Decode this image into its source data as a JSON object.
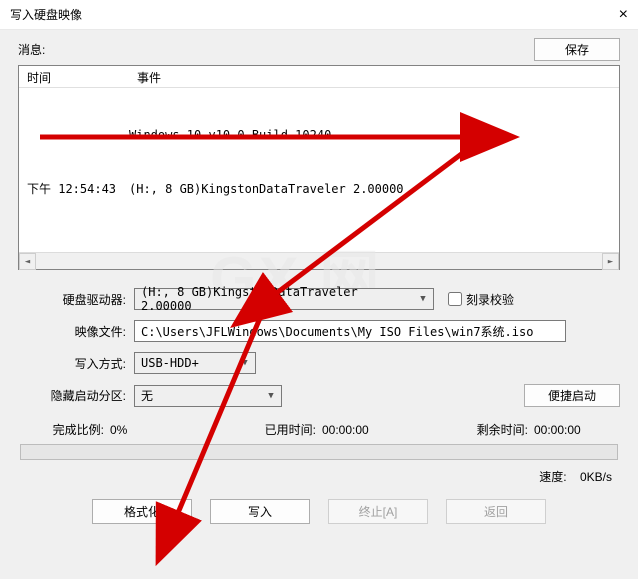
{
  "window": {
    "title": "写入硬盘映像"
  },
  "info": {
    "label": "消息:",
    "save_label": "保存",
    "col_time": "时间",
    "col_event": "事件",
    "rows": [
      {
        "time": "",
        "event": "Windows 10 v10.0 Build 10240"
      },
      {
        "time": "下午 12:54:43",
        "event": "(H:, 8 GB)KingstonDataTraveler 2.00000"
      }
    ]
  },
  "form": {
    "drive_label": "硬盘驱动器:",
    "drive_value": "(H:, 8 GB)KingstonDataTraveler 2.00000",
    "burn_check_label": "刻录校验",
    "image_label": "映像文件:",
    "image_value": "C:\\Users\\JFLWindows\\Documents\\My ISO Files\\win7系统.iso",
    "write_mode_label": "写入方式:",
    "write_mode_value": "USB-HDD+",
    "hidden_label": "隐藏启动分区:",
    "hidden_value": "无",
    "quick_boot_label": "便捷启动"
  },
  "progress": {
    "done_label": "完成比例:",
    "done_value": "0%",
    "elapsed_label": "已用时间:",
    "elapsed_value": "00:00:00",
    "remain_label": "剩余时间:",
    "remain_value": "00:00:00",
    "speed_label": "速度:",
    "speed_value": "0KB/s"
  },
  "buttons": {
    "format": "格式化",
    "write": "写入",
    "abort": "终止[A]",
    "back": "返回"
  },
  "watermark": "GX 网"
}
